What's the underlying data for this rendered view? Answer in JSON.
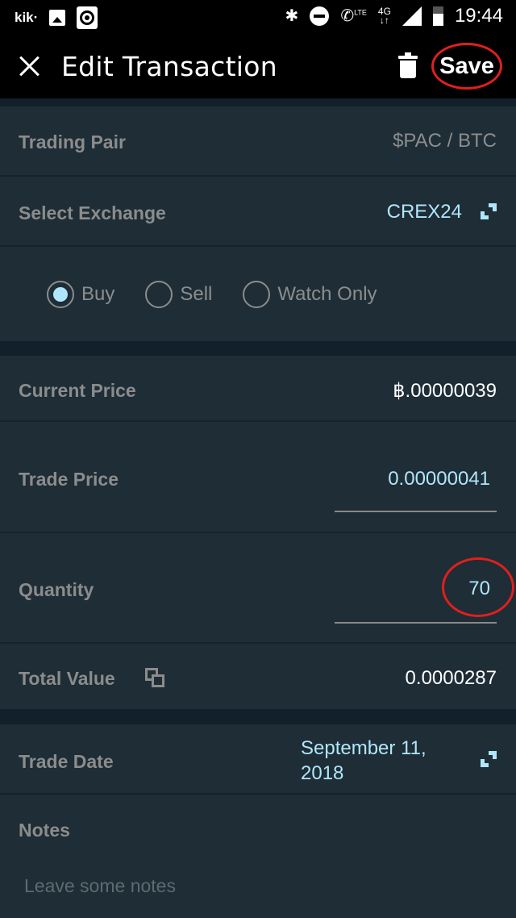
{
  "status_bar": {
    "left_icons": [
      "kik-icon",
      "image-icon",
      "target-icon"
    ],
    "kik_label": "kik·",
    "network_type": "4G",
    "lte_label": "LTE",
    "time": "19:44"
  },
  "toolbar": {
    "title": "Edit Transaction",
    "save_label": "Save",
    "close_icon": "close-icon",
    "delete_icon": "trash-icon"
  },
  "form": {
    "trading_pair": {
      "label": "Trading Pair",
      "value": "$PAC / BTC"
    },
    "exchange": {
      "label": "Select Exchange",
      "value": "CREX24",
      "icon": "expand-icon"
    },
    "transaction_type": {
      "options": [
        {
          "label": "Buy",
          "checked": true
        },
        {
          "label": "Sell",
          "checked": false
        },
        {
          "label": "Watch Only",
          "checked": false
        }
      ]
    },
    "current_price": {
      "label": "Current Price",
      "value": "฿.00000039"
    },
    "trade_price": {
      "label": "Trade Price",
      "value": "0.00000041"
    },
    "quantity": {
      "label": "Quantity",
      "value": "70"
    },
    "total_value": {
      "label": "Total Value",
      "value": "0.0000287",
      "icon": "copy-icon"
    },
    "trade_date": {
      "label": "Trade Date",
      "value": "September 11, 2018",
      "icon": "expand-icon"
    },
    "notes": {
      "label": "Notes",
      "placeholder": "Leave some notes",
      "value": ""
    }
  },
  "colors": {
    "accent": "#b0e6fb",
    "background": "#1e2d36",
    "divider": "#11202a",
    "annotation": "#e0201c"
  }
}
